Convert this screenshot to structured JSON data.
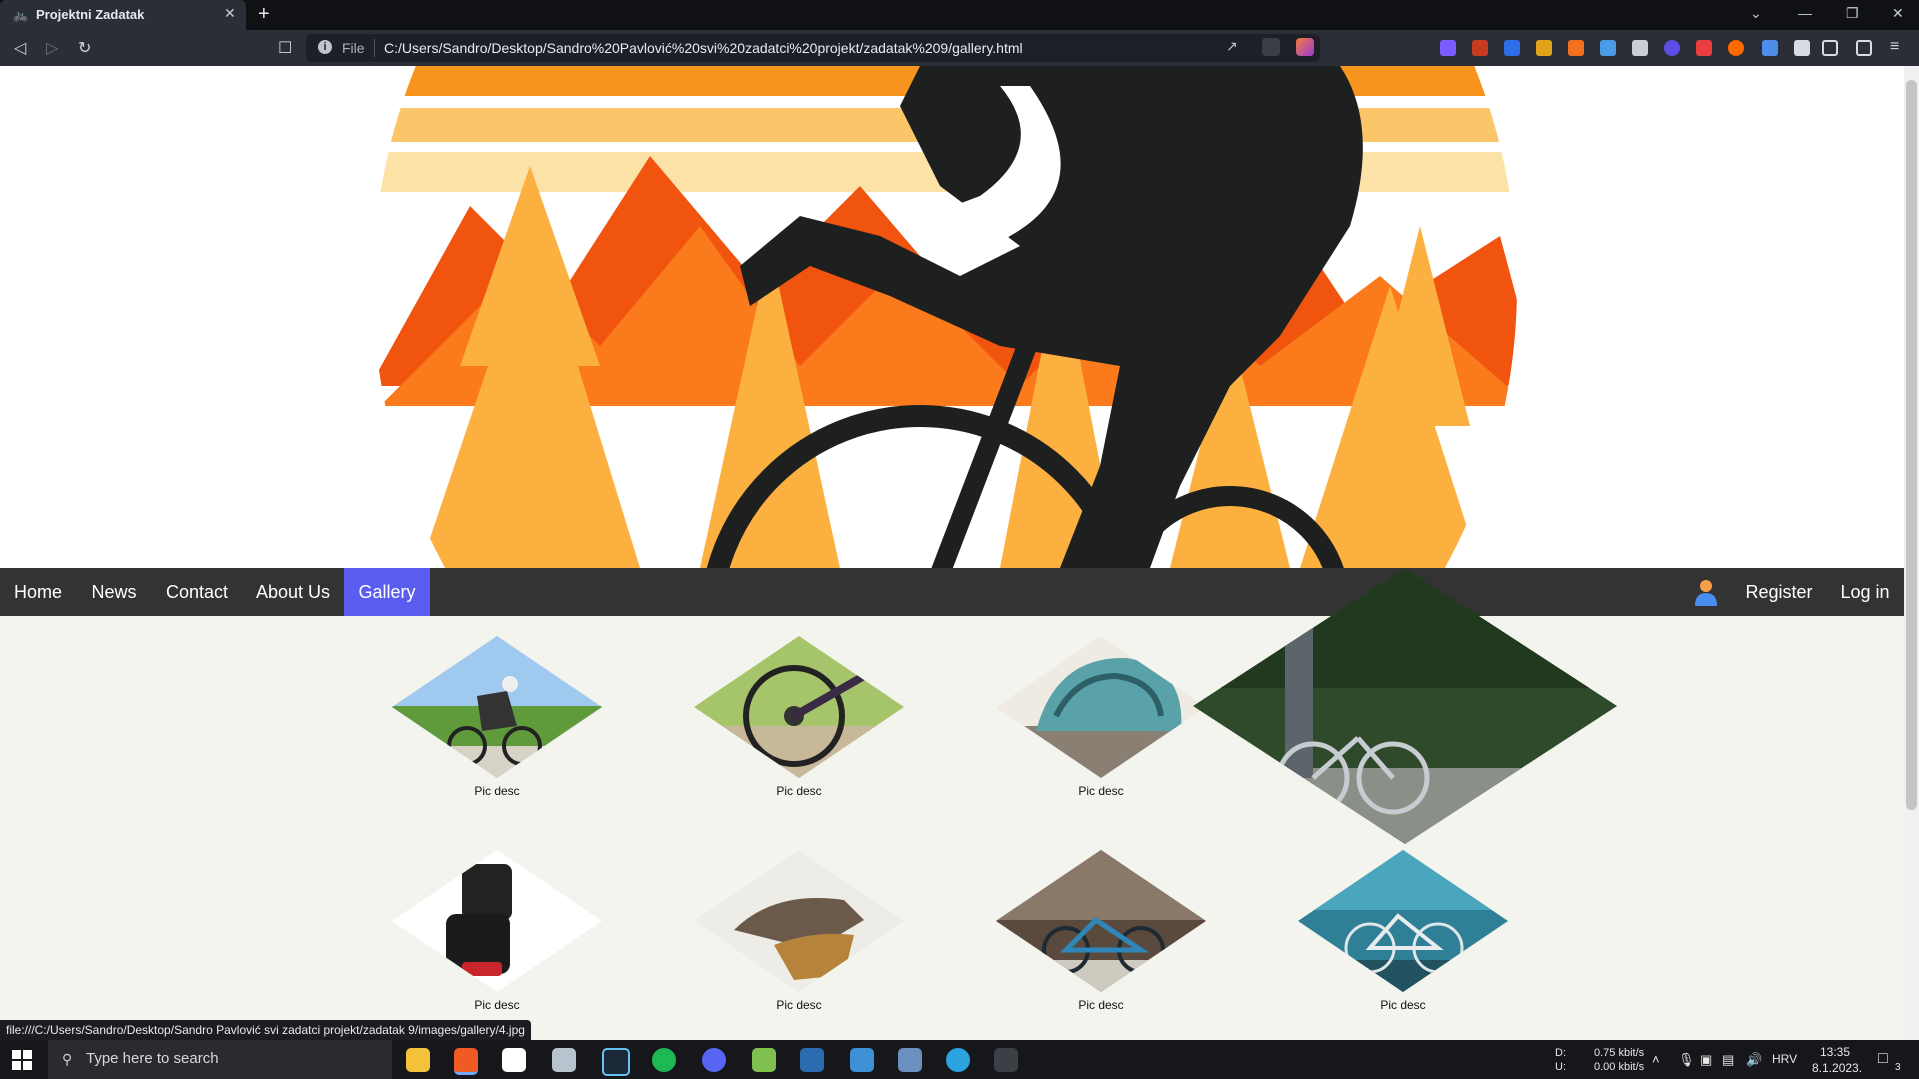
{
  "browser": {
    "tab_title": "Projektni Zadatak",
    "new_tab_symbol": "+",
    "address_scheme": "File",
    "url": "C:/Users/Sandro/Desktop/Sandro%20Pavlović%20svi%20zadatci%20projekt/zadatak%209/gallery.html",
    "status_url": "file:///C:/Users/Sandro/Desktop/Sandro Pavlović svi zadatci projekt/zadatak 9/images/gallery/4.jpg"
  },
  "nav": {
    "items": [
      "Home",
      "News",
      "Contact",
      "About Us",
      "Gallery"
    ],
    "active": "Gallery",
    "register": "Register",
    "login": "Log in"
  },
  "gallery": {
    "items": [
      {
        "desc": "Pic desc",
        "icon": "cyclist-photo"
      },
      {
        "desc": "Pic desc",
        "icon": "bike-drivetrain-photo"
      },
      {
        "desc": "Pic desc",
        "icon": "helmet-photo"
      },
      {
        "desc": "",
        "icon": "bmx-rider-photo"
      },
      {
        "desc": "Pic desc",
        "icon": "pedals-photo"
      },
      {
        "desc": "Pic desc",
        "icon": "shoes-photo"
      },
      {
        "desc": "Pic desc",
        "icon": "bike-rocks-photo"
      },
      {
        "desc": "Pic desc",
        "icon": "road-bike-photo"
      }
    ]
  },
  "taskbar": {
    "search_placeholder": "Type here to search",
    "net_d_label": "D:",
    "net_u_label": "U:",
    "net_down": "0.75 kbit/s",
    "net_up": "0.00 kbit/s",
    "language": "HRV",
    "time": "13:35",
    "date": "8.1.2023.",
    "notifications": "3"
  },
  "colors": {
    "nav_bg": "#333333",
    "nav_active": "#5b5cf0",
    "page_bg": "#f4f4ef"
  }
}
